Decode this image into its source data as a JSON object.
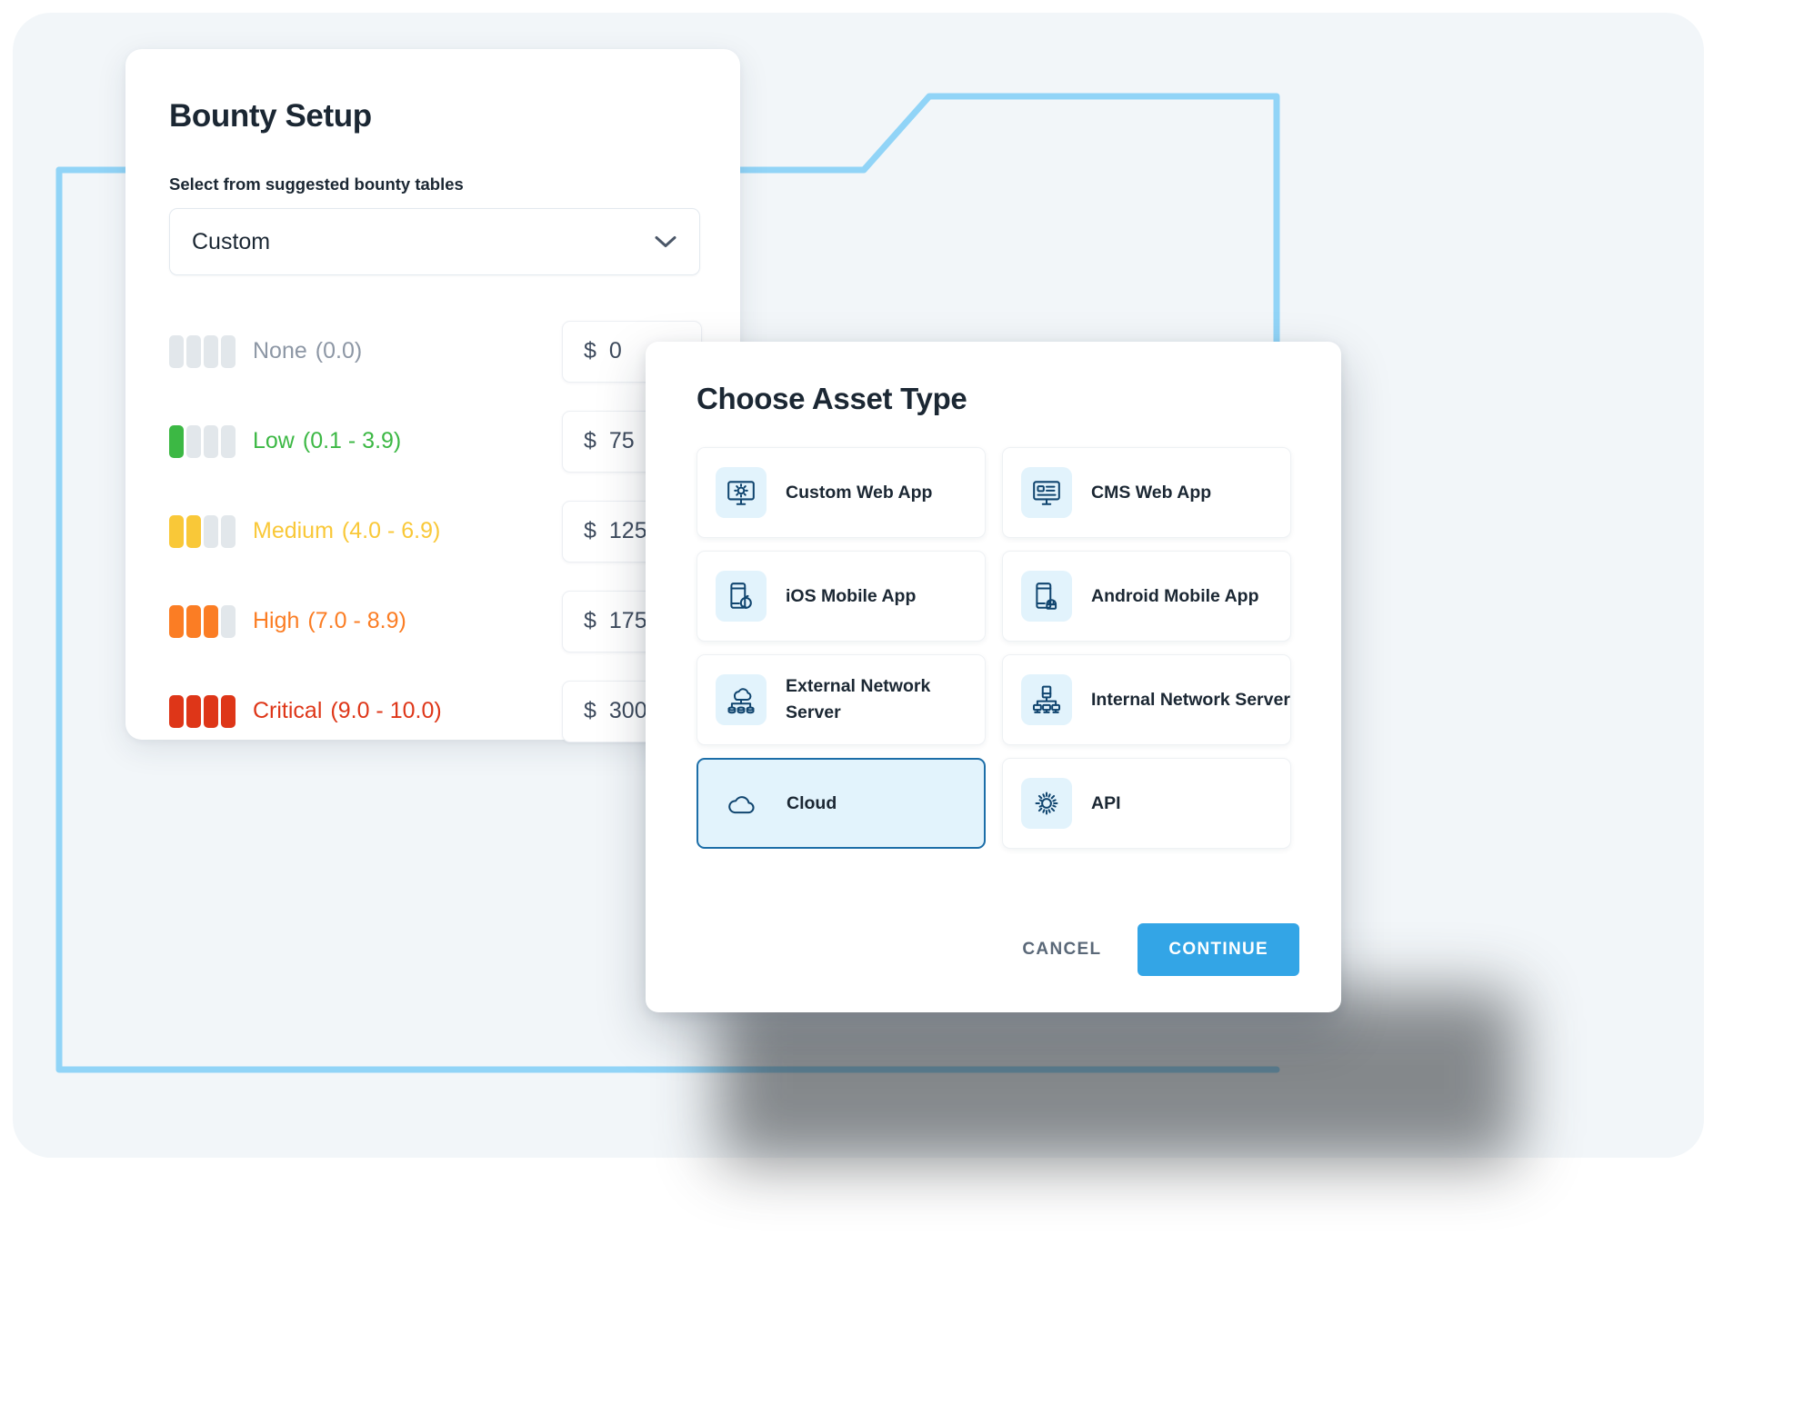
{
  "theme": {
    "panel_bg": "#f2f6f9",
    "deco_line": "#91d4f7",
    "accent_blue": "#33a5e6",
    "icon_navy": "#10456f",
    "icon_tile_bg": "#e2f3fc",
    "selected_border": "#1c6ea8",
    "text_dark": "#1b2733"
  },
  "bounty_setup": {
    "title": "Bounty Setup",
    "field_label": "Select from suggested bounty tables",
    "select": {
      "value": "Custom",
      "icon": "chevron-down-icon"
    },
    "severities": [
      {
        "name": "None",
        "range": "(0.0)",
        "filled": 0,
        "color": "#8d97a5",
        "amount": "0",
        "currency": "$"
      },
      {
        "name": "Low",
        "range": "(0.1 - 3.9)",
        "filled": 1,
        "color": "#3cb844",
        "amount": "75",
        "currency": "$"
      },
      {
        "name": "Medium",
        "range": "(4.0 - 6.9)",
        "filled": 2,
        "color": "#f9c838",
        "amount": "125",
        "currency": "$"
      },
      {
        "name": "High",
        "range": "(7.0 - 8.9)",
        "filled": 3,
        "color": "#fb7d24",
        "amount": "175",
        "currency": "$"
      },
      {
        "name": "Critical",
        "range": "(9.0 - 10.0)",
        "filled": 4,
        "color": "#de3618",
        "amount": "300",
        "currency": "$"
      }
    ]
  },
  "asset_modal": {
    "title": "Choose Asset Type",
    "options": [
      {
        "label": "Custom Web App",
        "icon": "monitor-gear-icon",
        "selected": false
      },
      {
        "label": "CMS Web App",
        "icon": "monitor-content-icon",
        "selected": false
      },
      {
        "label": "iOS Mobile App",
        "icon": "phone-apple-icon",
        "selected": false
      },
      {
        "label": "Android Mobile App",
        "icon": "phone-android-icon",
        "selected": false
      },
      {
        "label": "External Network Server",
        "icon": "cloud-network-icon",
        "selected": false
      },
      {
        "label": "Internal Network Server",
        "icon": "server-network-icon",
        "selected": false
      },
      {
        "label": "Cloud",
        "icon": "cloud-icon",
        "selected": true
      },
      {
        "label": "API",
        "icon": "gear-icon",
        "selected": false
      }
    ],
    "cancel_label": "CANCEL",
    "continue_label": "CONTINUE"
  }
}
